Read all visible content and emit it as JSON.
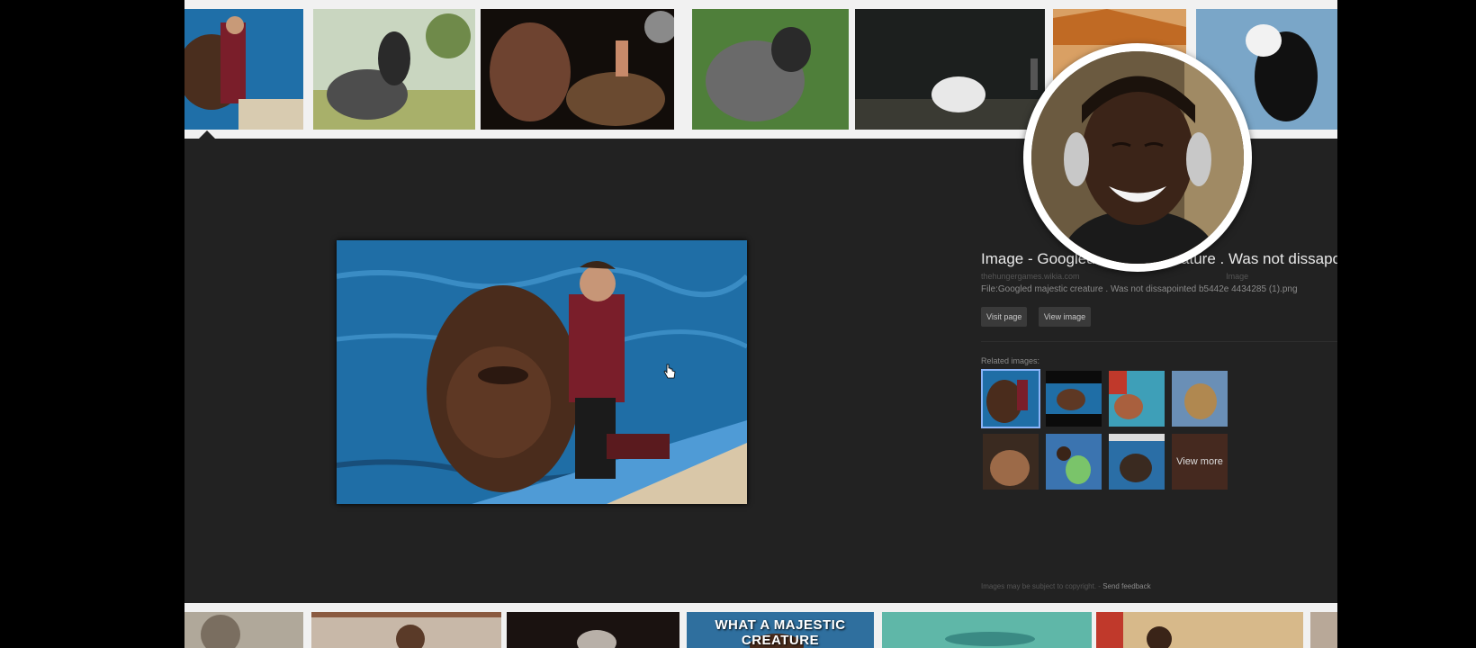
{
  "preview": {
    "title": "Image - Googled majestic creature . Was not dissapo",
    "source": "thehungergames.wikia.com",
    "source_suffix": "Image",
    "filename": "File:Googled majestic creature . Was not dissapointed b5442e 4434285 (1).png",
    "visit_page_label": "Visit page",
    "view_image_label": "View image",
    "related_label": "Related images:",
    "view_more_label": "View more",
    "footer_text": "Images may be subject to copyright. -",
    "feedback_label": "Send feedback"
  },
  "bottom_strip": {
    "caption": "WHAT A MAJESTIC CREATURE"
  },
  "colors": {
    "panel_bg": "#222222",
    "strip_bg": "#f1f1f1",
    "selection_outline": "#8ab4f8"
  }
}
